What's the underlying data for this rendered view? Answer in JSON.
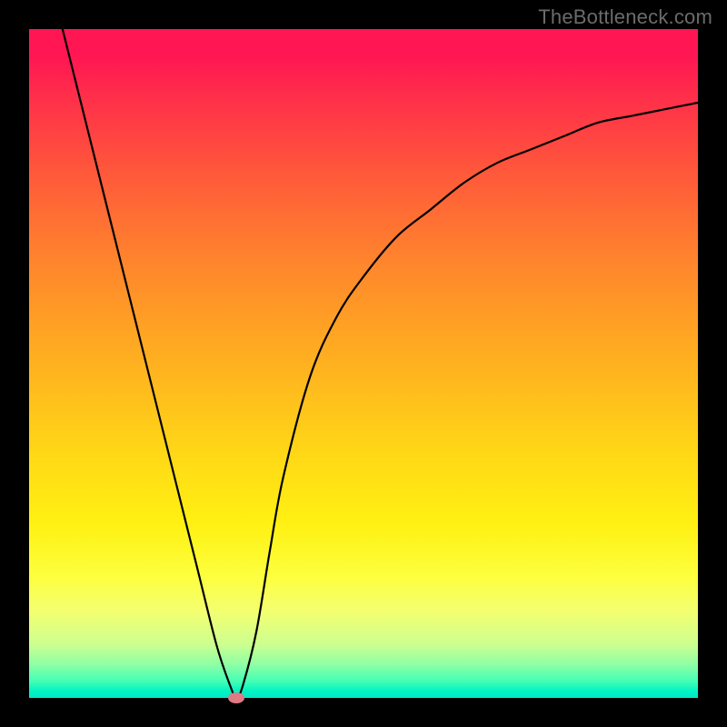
{
  "watermark": "TheBottleneck.com",
  "colors": {
    "frame": "#000000",
    "curve": "#000000",
    "marker": "#e07a84"
  },
  "chart_data": {
    "type": "line",
    "title": "",
    "xlabel": "",
    "ylabel": "",
    "xlim": [
      0,
      100
    ],
    "ylim": [
      0,
      100
    ],
    "grid": false,
    "legend": false,
    "series": [
      {
        "name": "bottleneck-curve",
        "x": [
          5,
          10,
          15,
          20,
          25,
          28,
          30,
          31,
          32,
          34,
          36,
          38,
          42,
          46,
          50,
          55,
          60,
          65,
          70,
          75,
          80,
          85,
          90,
          95,
          100
        ],
        "y": [
          100,
          80,
          60,
          40,
          20,
          8,
          2,
          0,
          2,
          10,
          22,
          33,
          48,
          57,
          63,
          69,
          73,
          77,
          80,
          82,
          84,
          86,
          87,
          88,
          89
        ]
      }
    ],
    "annotations": [
      {
        "type": "marker",
        "x": 31,
        "y": 0,
        "shape": "ellipse",
        "color": "#e07a84"
      }
    ],
    "background_gradient": {
      "direction": "vertical",
      "stops": [
        {
          "pos": 0.0,
          "color": "#ff1653"
        },
        {
          "pos": 0.33,
          "color": "#ff7f2e"
        },
        {
          "pos": 0.64,
          "color": "#ffd916"
        },
        {
          "pos": 0.82,
          "color": "#fdff40"
        },
        {
          "pos": 1.0,
          "color": "#00e8c8"
        }
      ]
    }
  }
}
